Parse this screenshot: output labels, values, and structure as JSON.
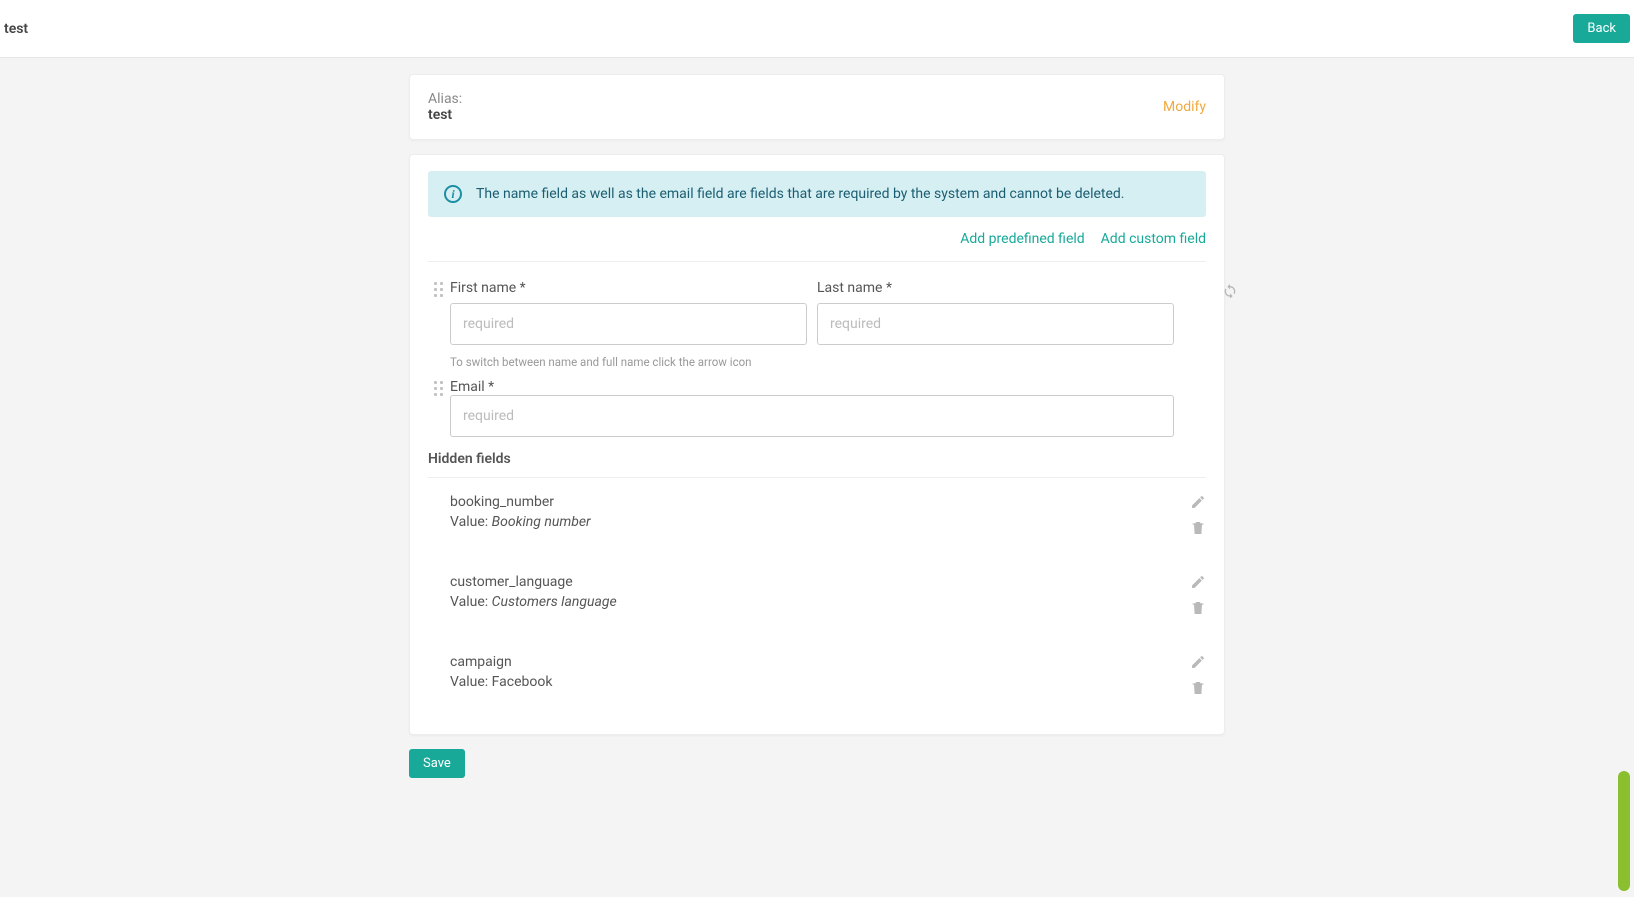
{
  "header": {
    "title": "test",
    "back_label": "Back"
  },
  "alias": {
    "label": "Alias:",
    "value": "test",
    "modify_label": "Modify"
  },
  "info_banner": "The name field as well as the email field are fields that are required by the system and cannot be deleted.",
  "actions": {
    "add_predefined": "Add predefined field",
    "add_custom": "Add custom field"
  },
  "fields": {
    "first_name": {
      "label": "First name *",
      "placeholder": "required"
    },
    "last_name": {
      "label": "Last name *",
      "placeholder": "required"
    },
    "switch_hint": "To switch between name and full name click the arrow icon",
    "email": {
      "label": "Email *",
      "placeholder": "required"
    }
  },
  "hidden_section_title": "Hidden fields",
  "hidden_fields": [
    {
      "name": "booking_number",
      "value_label": "Value: ",
      "value": "Booking number",
      "italic": true
    },
    {
      "name": "customer_language",
      "value_label": "Value: ",
      "value": "Customers language",
      "italic": true
    },
    {
      "name": "campaign",
      "value_label": "Value: ",
      "value": "Facebook",
      "italic": false
    }
  ],
  "save_label": "Save"
}
